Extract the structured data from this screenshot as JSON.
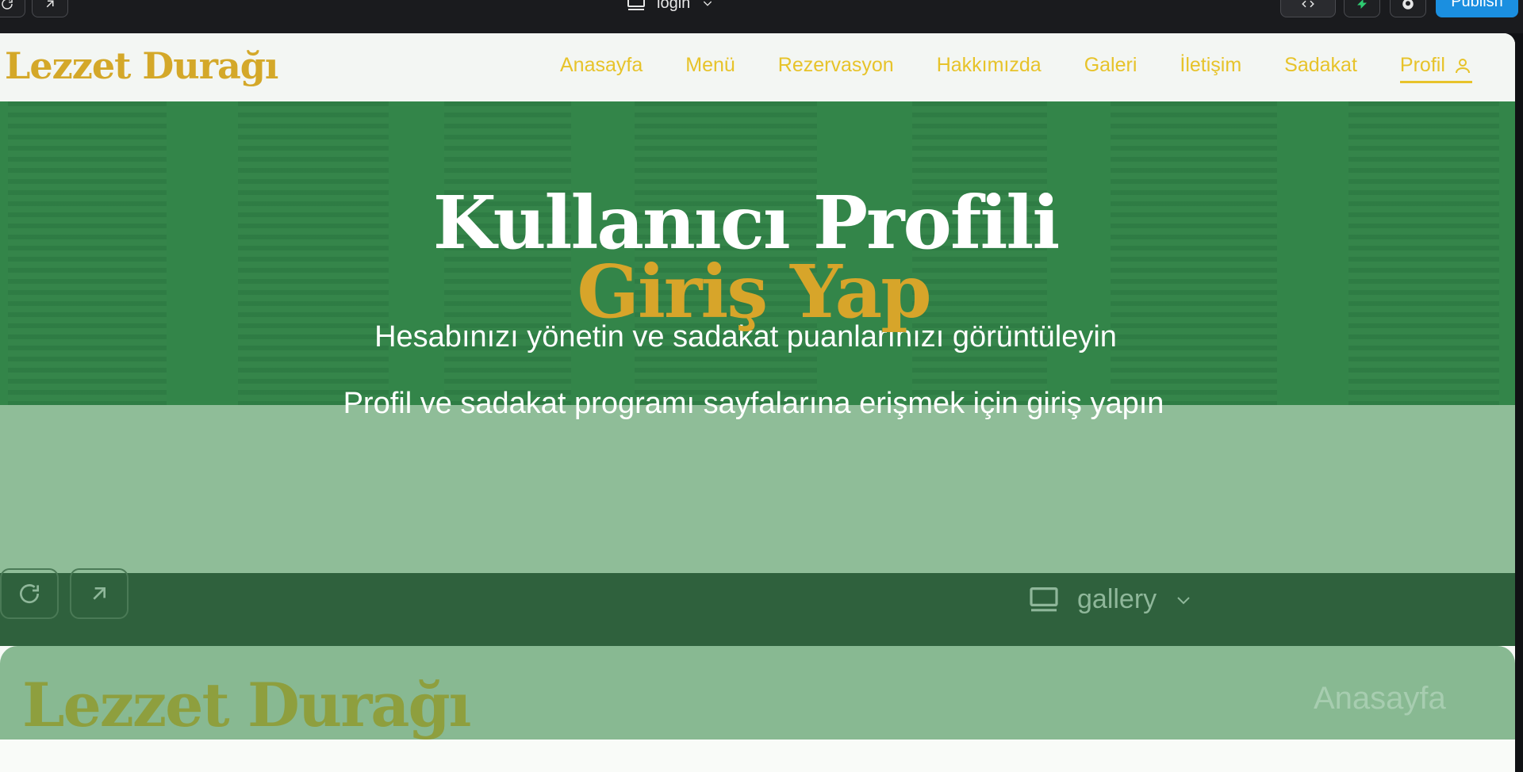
{
  "editor": {
    "page_selector": "login",
    "publish_label": "Publish"
  },
  "site": {
    "logo": "Lezzet Durağı",
    "nav": [
      {
        "label": "Anasayfa"
      },
      {
        "label": "Menü"
      },
      {
        "label": "Rezervasyon"
      },
      {
        "label": "Hakkımızda"
      },
      {
        "label": "Galeri"
      },
      {
        "label": "İletişim"
      },
      {
        "label": "Sadakat"
      },
      {
        "label": "Profil"
      }
    ],
    "hero": {
      "title": "Kullanıcı Profili",
      "subtitle": "Hesabınızı yönetin ve sadakat puanlarınızı görüntüleyin"
    },
    "login": {
      "title": "Giriş Yap",
      "subtitle": "Profil ve sadakat programı sayfalarına erişmek için giriş yapın"
    }
  },
  "ghost": {
    "page_selector": "gallery",
    "logo": "Lezzet Durağı",
    "nav_first": "Anasayfa"
  },
  "colors": {
    "accent_gold": "#d4a829",
    "nav_yellow": "#e7c32a",
    "hero_green": "#3a8a4f",
    "publish_blue": "#1b8fe0"
  }
}
